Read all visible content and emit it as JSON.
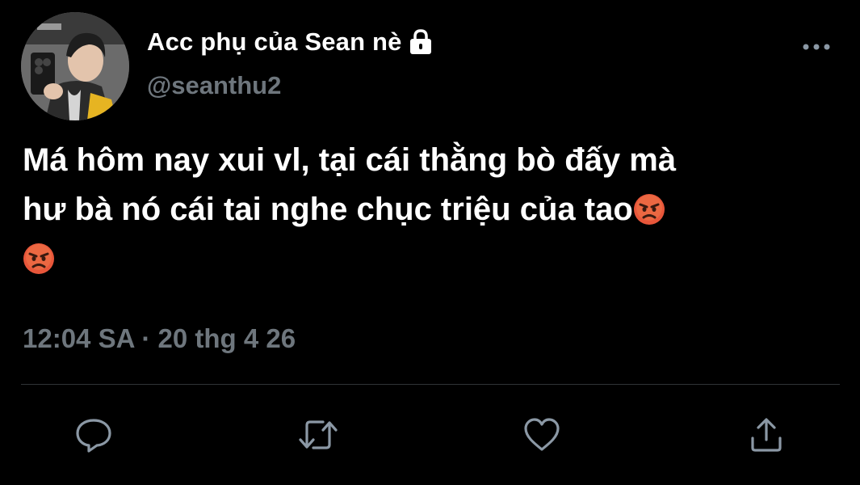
{
  "tweet": {
    "display_name": "Acc phụ của Sean nè",
    "handle": "@seanthu2",
    "text_line1": "Má hôm nay xui vl, tại cái thằng bò đấy mà",
    "text_line2": "hư bà nó cái tai nghe chục triệu của tao",
    "timestamp": "12:04 SA · 20 thg 4 26",
    "protected_icon": "lock-icon",
    "emoji": "angry-face-emoji"
  },
  "actions": {
    "reply_icon": "reply-icon",
    "retweet_icon": "retweet-icon",
    "like_icon": "heart-icon",
    "share_icon": "share-icon",
    "more_icon": "more-options-icon"
  },
  "colors": {
    "background": "#000000",
    "text": "#ffffff",
    "secondary_text": "#6e767d",
    "divider": "#2f3336",
    "icon": "#8b98a5"
  }
}
